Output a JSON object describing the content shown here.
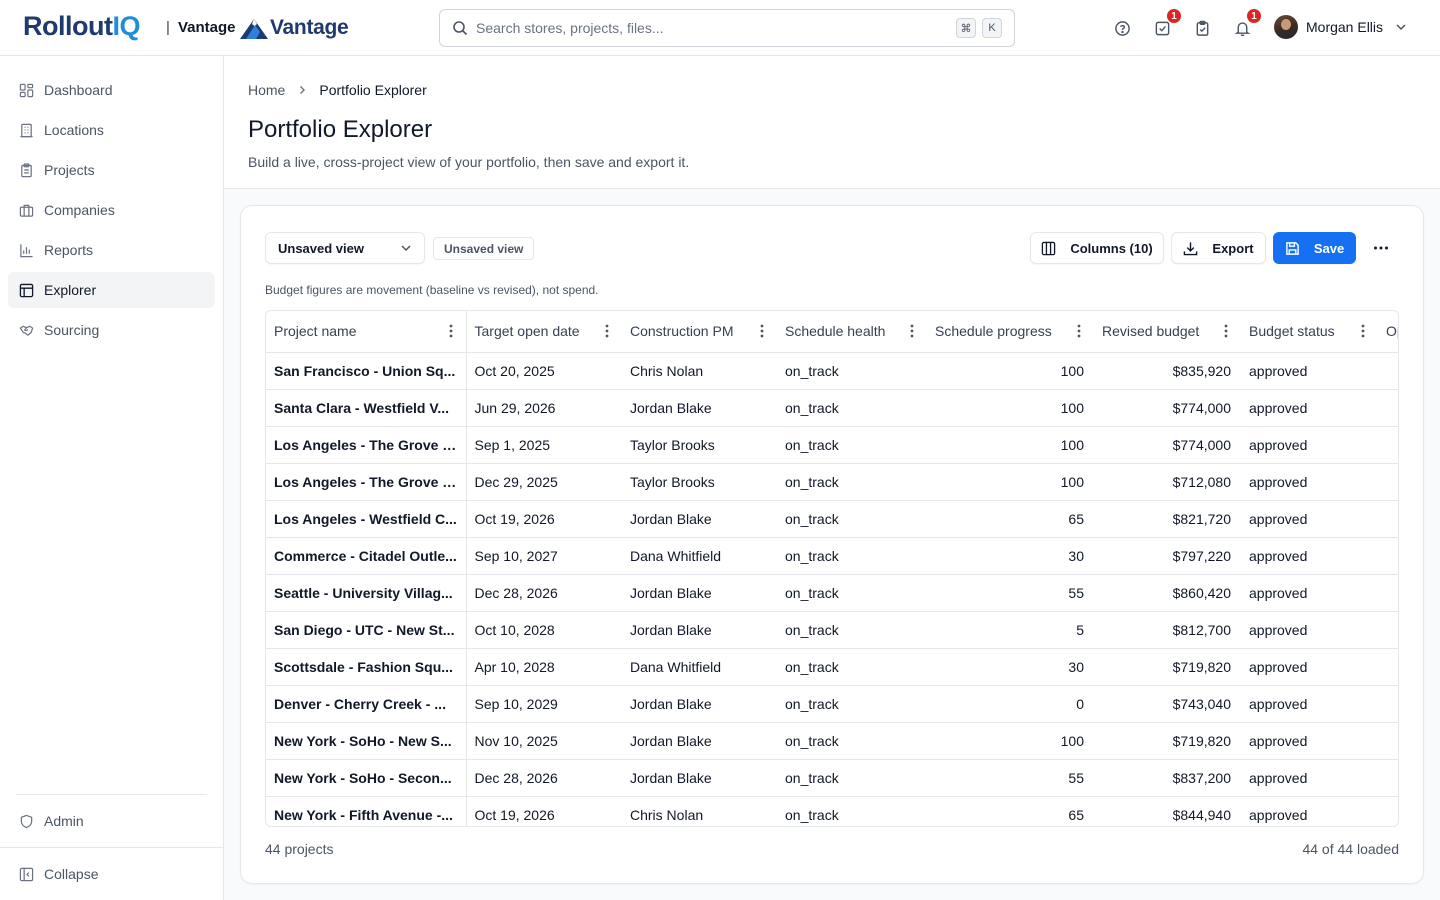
{
  "app": {
    "logo_main": "Rollout",
    "logo_accent": "IQ",
    "separator": "|",
    "tenant": "Vantage",
    "tenant_logo_text": "Vantage",
    "accent_color": "#1670f2"
  },
  "search": {
    "placeholder": "Search stores, projects, files...",
    "shortcut_mod": "⌘",
    "shortcut_key": "K"
  },
  "header_icons": [
    {
      "icon": "help-circle-icon"
    },
    {
      "icon": "task-check-icon",
      "badge": "1"
    },
    {
      "icon": "clipboard-check-icon"
    },
    {
      "icon": "bell-icon",
      "badge": "1"
    }
  ],
  "user": {
    "name": "Morgan Ellis",
    "icon": "avatar"
  },
  "sidebar": {
    "items": [
      {
        "label": "Dashboard",
        "icon": "dashboard-icon"
      },
      {
        "label": "Locations",
        "icon": "building-icon"
      },
      {
        "label": "Projects",
        "icon": "clipboard-icon"
      },
      {
        "label": "Companies",
        "icon": "briefcase-icon"
      },
      {
        "label": "Reports",
        "icon": "bar-chart-icon"
      },
      {
        "label": "Explorer",
        "icon": "table-icon",
        "active": true
      },
      {
        "label": "Sourcing",
        "icon": "handshake-icon"
      }
    ],
    "admin": {
      "label": "Admin",
      "icon": "shield-icon"
    },
    "collapse": {
      "label": "Collapse",
      "icon": "collapse-sidebar-icon"
    }
  },
  "breadcrumb": {
    "home": "Home",
    "current": "Portfolio Explorer"
  },
  "page": {
    "title": "Portfolio Explorer",
    "subtitle": "Build a live, cross-project view of your portfolio, then save and export it."
  },
  "toolbar": {
    "view_select": "Unsaved view",
    "view_pill": "Unsaved view",
    "columns_label": "Columns (10)",
    "export_label": "Export",
    "save_label": "Save"
  },
  "note": "Budget figures are movement (baseline vs revised), not spend.",
  "table": {
    "columns": [
      "Project name",
      "Target open date",
      "Construction PM",
      "Schedule health",
      "Schedule progress",
      "Revised budget",
      "Budget status",
      "Op"
    ],
    "rows": [
      [
        "San Francisco - Union Sq...",
        "Oct 20, 2025",
        "Chris Nolan",
        "on_track",
        "100",
        "$835,920",
        "approved"
      ],
      [
        "Santa Clara - Westfield V...",
        "Jun 29, 2026",
        "Jordan Blake",
        "on_track",
        "100",
        "$774,000",
        "approved"
      ],
      [
        "Los Angeles - The Grove -...",
        "Sep 1, 2025",
        "Taylor Brooks",
        "on_track",
        "100",
        "$774,000",
        "approved"
      ],
      [
        "Los Angeles - The Grove -...",
        "Dec 29, 2025",
        "Taylor Brooks",
        "on_track",
        "100",
        "$712,080",
        "approved"
      ],
      [
        "Los Angeles - Westfield C...",
        "Oct 19, 2026",
        "Jordan Blake",
        "on_track",
        "65",
        "$821,720",
        "approved"
      ],
      [
        "Commerce - Citadel Outle...",
        "Sep 10, 2027",
        "Dana Whitfield",
        "on_track",
        "30",
        "$797,220",
        "approved"
      ],
      [
        "Seattle - University Villag...",
        "Dec 28, 2026",
        "Jordan Blake",
        "on_track",
        "55",
        "$860,420",
        "approved"
      ],
      [
        "San Diego - UTC - New St...",
        "Oct 10, 2028",
        "Jordan Blake",
        "on_track",
        "5",
        "$812,700",
        "approved"
      ],
      [
        "Scottsdale - Fashion Squ...",
        "Apr 10, 2028",
        "Dana Whitfield",
        "on_track",
        "30",
        "$719,820",
        "approved"
      ],
      [
        "Denver - Cherry Creek - ...",
        "Sep 10, 2029",
        "Jordan Blake",
        "on_track",
        "0",
        "$743,040",
        "approved"
      ],
      [
        "New York - SoHo - New S...",
        "Nov 10, 2025",
        "Jordan Blake",
        "on_track",
        "100",
        "$719,820",
        "approved"
      ],
      [
        "New York - SoHo - Secon...",
        "Dec 28, 2026",
        "Jordan Blake",
        "on_track",
        "55",
        "$837,200",
        "approved"
      ],
      [
        "New York - Fifth Avenue -...",
        "Oct 19, 2026",
        "Chris Nolan",
        "on_track",
        "65",
        "$844,940",
        "approved"
      ]
    ]
  },
  "footer": {
    "count": "44 projects",
    "loaded": "44 of 44 loaded"
  }
}
